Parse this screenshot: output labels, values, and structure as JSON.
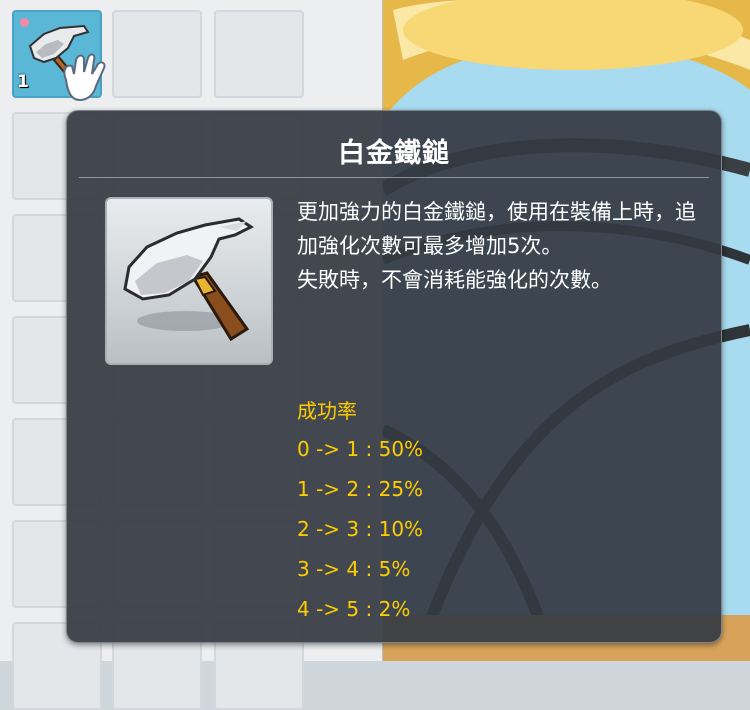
{
  "inventory": {
    "selected_slot": {
      "icon": "platinum-hammer-icon",
      "quantity": "1"
    }
  },
  "tooltip": {
    "title": "白金鐵鎚",
    "icon": "platinum-hammer-icon",
    "description": [
      "更加強力的白金鐵鎚，使用在裝備上時，追加強化次數可最多增加5次。",
      "失敗時，不會消耗能強化的次數。"
    ],
    "success_rate": {
      "label": "成功率",
      "rows": [
        "0 -> 1 : 50%",
        "1 -> 2 : 25%",
        "2 -> 3 : 10%",
        "3 -> 4 : 5%",
        "4 -> 5 : 2%"
      ]
    }
  },
  "colors": {
    "tooltip_bg": "#343a42",
    "title_text": "#ffffff",
    "rate_text": "#ffcc00",
    "selected_slot": "#5bb7d6"
  }
}
